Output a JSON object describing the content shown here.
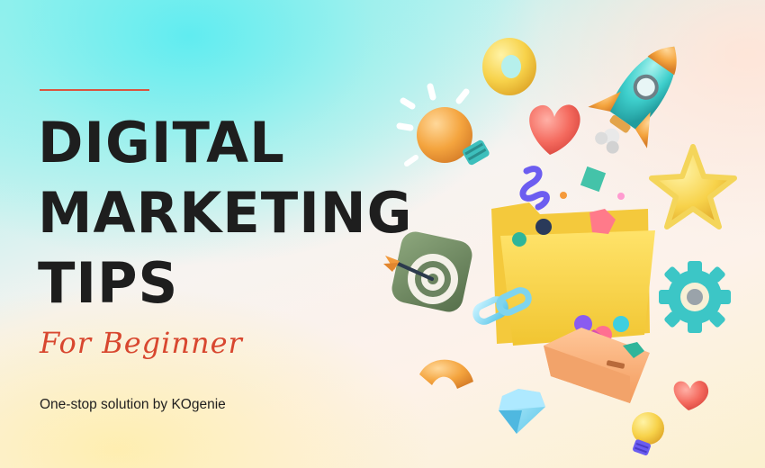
{
  "heading": {
    "line1": "DIGITAL",
    "line2": "MARKETING",
    "line3": "TIPS"
  },
  "tagline": "For Beginner",
  "subtitle": "One-stop solution by  KOgenie",
  "illustrations": [
    "donut-icon",
    "rocket-icon",
    "lightbulb-icon",
    "heart-icon",
    "star-icon",
    "folder-icon",
    "target-icon",
    "dart-icon",
    "gear-icon",
    "chain-link-icon",
    "box-icon",
    "diamond-icon",
    "small-lightbulb-icon",
    "small-heart-icon",
    "squiggle-icon",
    "arch-icon",
    "cube-icon",
    "gem-icon"
  ],
  "colors": {
    "title": "#1e1e1e",
    "accent": "#d8472f",
    "rule": "#d9553f"
  }
}
